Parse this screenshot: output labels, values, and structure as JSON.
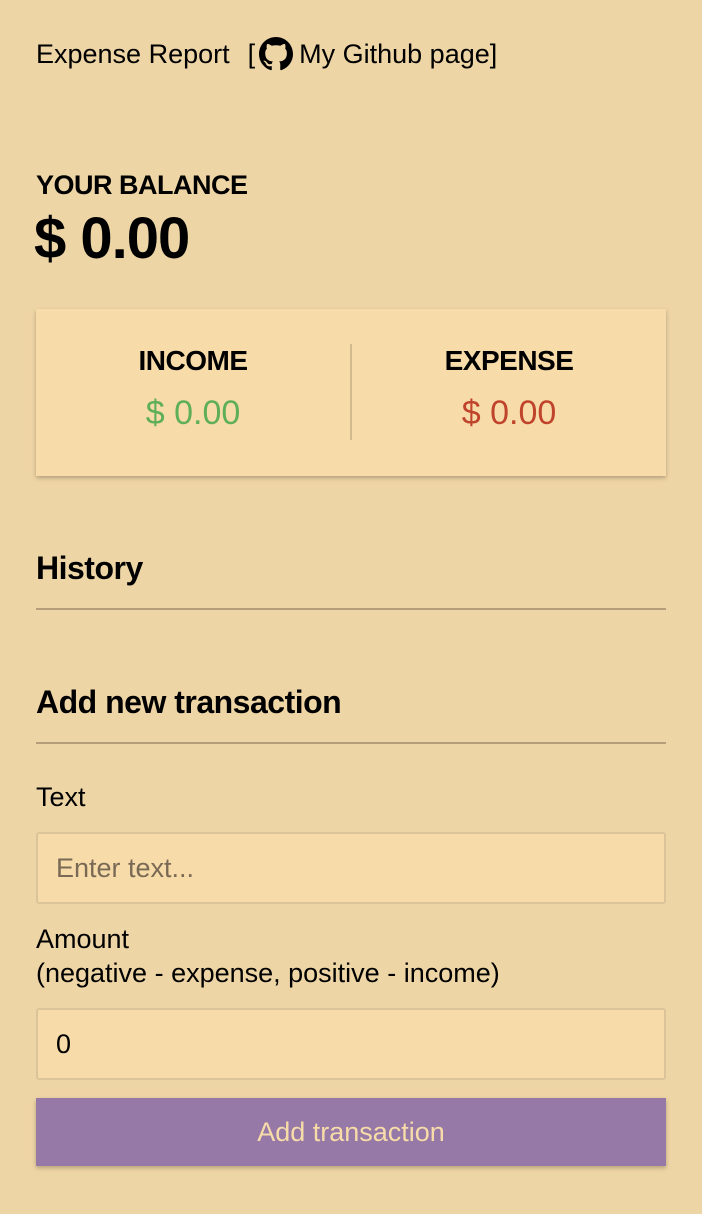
{
  "header": {
    "title": "Expense Report",
    "bracket_open": "[",
    "github_link_label": "My Github page",
    "bracket_close": "]",
    "github_icon": "github-icon"
  },
  "balance": {
    "label": "YOUR BALANCE",
    "value": "$ 0.00"
  },
  "summary": {
    "income_label": "INCOME",
    "income_value": "$ 0.00",
    "expense_label": "EXPENSE",
    "expense_value": "$ 0.00",
    "income_color": "#5fae58",
    "expense_color": "#c0432b"
  },
  "history": {
    "title": "History"
  },
  "form": {
    "title": "Add new transaction",
    "text_label": "Text",
    "text_placeholder": "Enter text...",
    "amount_label": "Amount",
    "amount_hint": "(negative - expense, positive - income)",
    "amount_value": "0",
    "submit_label": "Add transaction"
  },
  "colors": {
    "background": "#eed5a5",
    "card": "#f7dca9",
    "button": "#9679a6",
    "button_text": "#f7dca9"
  }
}
